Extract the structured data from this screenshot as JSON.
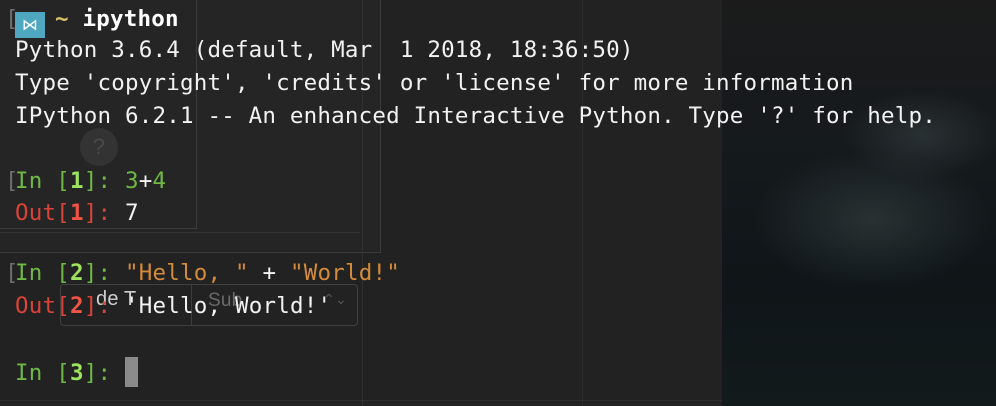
{
  "prompt": {
    "logo_glyph": "⋈",
    "tilde": "~",
    "command": "ipython"
  },
  "banner": {
    "line1": "Python 3.6.4 (default, Mar  1 2018, 18:36:50)",
    "line2": "Type 'copyright', 'credits' or 'license' for more information",
    "line3": "IPython 6.2.1 -- An enhanced Interactive Python. Type '?' for help."
  },
  "cells": [
    {
      "in_label": "In",
      "in_number": "1",
      "code_left": "3",
      "code_op": "+",
      "code_right": "4",
      "out_label": "Out",
      "out_number": "1",
      "output": "7"
    },
    {
      "in_label": "In",
      "in_number": "2",
      "code_left": "\"Hello, \"",
      "code_op": " + ",
      "code_right": "\"World!\"",
      "out_label": "Out",
      "out_number": "2",
      "output": "'Hello, World!'"
    },
    {
      "in_label": "In",
      "in_number": "3"
    }
  ],
  "background_ghost": {
    "help_glyph": "?",
    "label_a": "de T",
    "label_b": "Sub",
    "chevron": "⌃⌄"
  },
  "colors": {
    "background": "#222222",
    "in_prompt": "#6fb846",
    "out_prompt": "#d9443a",
    "string": "#d28a3b",
    "logo": "#4fa8bf",
    "tilde": "#d9c36a"
  }
}
